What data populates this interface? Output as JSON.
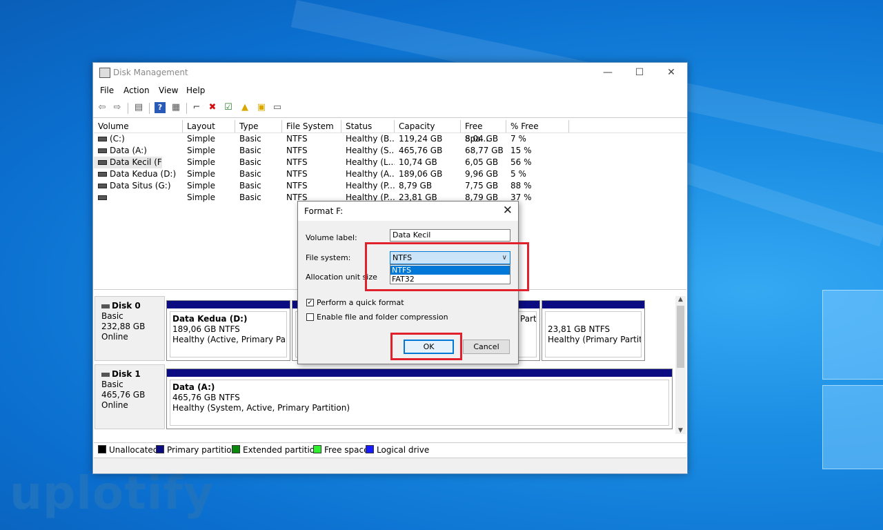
{
  "window": {
    "title": "Disk Management",
    "controls": {
      "minimize": "—",
      "maximize": "☐",
      "close": "✕"
    }
  },
  "menu": [
    "File",
    "Action",
    "View",
    "Help"
  ],
  "table": {
    "columns": [
      "Volume",
      "Layout",
      "Type",
      "File System",
      "Status",
      "Capacity",
      "Free Spa...",
      "% Free"
    ],
    "rows": [
      [
        "(C:)",
        "Simple",
        "Basic",
        "NTFS",
        "Healthy (B...",
        "119,24 GB",
        "8,04 GB",
        "7 %"
      ],
      [
        "Data (A:)",
        "Simple",
        "Basic",
        "NTFS",
        "Healthy (S...",
        "465,76 GB",
        "68,77 GB",
        "15 %"
      ],
      [
        "Data Kecil (F:)",
        "Simple",
        "Basic",
        "NTFS",
        "Healthy (L...",
        "10,74 GB",
        "6,05 GB",
        "56 %"
      ],
      [
        "Data Kedua (D:)",
        "Simple",
        "Basic",
        "NTFS",
        "Healthy (A...",
        "189,06 GB",
        "9,96 GB",
        "5 %"
      ],
      [
        "Data Situs (G:)",
        "Simple",
        "Basic",
        "NTFS",
        "Healthy (P...",
        "8,79 GB",
        "7,75 GB",
        "88 %"
      ],
      [
        "",
        "Simple",
        "Basic",
        "NTFS",
        "Healthy (P...",
        "23,81 GB",
        "8,79 GB",
        "37 %"
      ]
    ]
  },
  "disks": [
    {
      "name": "Disk 0",
      "type": "Basic",
      "size": "232,88 GB",
      "state": "Online",
      "partitions": [
        {
          "name": "Data Kedua  (D:)",
          "size": "189,06 GB NTFS",
          "status": "Healthy (Active, Primary Partition)"
        },
        {
          "name": "",
          "size": "",
          "status": "Parti"
        },
        {
          "name": "",
          "size": "23,81 GB NTFS",
          "status": "Healthy (Primary Partition"
        }
      ]
    },
    {
      "name": "Disk 1",
      "type": "Basic",
      "size": "465,76 GB",
      "state": "Online",
      "partitions": [
        {
          "name": "Data  (A:)",
          "size": "465,76 GB NTFS",
          "status": "Healthy (System, Active, Primary Partition)"
        }
      ]
    }
  ],
  "legend": [
    {
      "label": "Unallocated",
      "color": "#000000"
    },
    {
      "label": "Primary partition",
      "color": "#0b0b82"
    },
    {
      "label": "Extended partition",
      "color": "#0a8a0a"
    },
    {
      "label": "Free space",
      "color": "#2ef02e"
    },
    {
      "label": "Logical drive",
      "color": "#1a1aff"
    }
  ],
  "dialog": {
    "title": "Format F:",
    "volume_label_text": "Volume label:",
    "volume_label_value": "Data Kecil",
    "file_system_text": "File system:",
    "file_system_value": "NTFS",
    "file_system_options": [
      "NTFS",
      "FAT32"
    ],
    "allocation_text": "Allocation unit size",
    "quick_format": "Perform a quick format",
    "compression": "Enable file and folder compression",
    "ok": "OK",
    "cancel": "Cancel"
  },
  "watermark": "uplotify"
}
